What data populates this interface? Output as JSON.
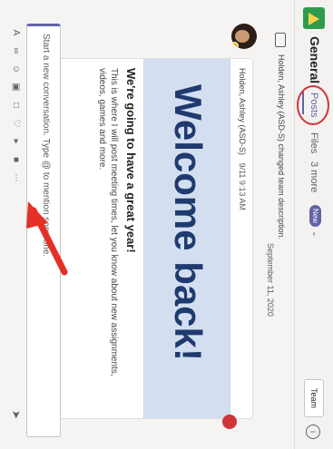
{
  "header": {
    "channel_name": "General",
    "tabs": [
      {
        "label": "Posts"
      },
      {
        "label": "Files"
      },
      {
        "label": "3 more"
      }
    ],
    "new_badge": "New",
    "team_button": "Team"
  },
  "system_message": {
    "text": "Holden, Ashley (ASD-S) changed team description.",
    "date": "September 11, 2020"
  },
  "post": {
    "author": "Holden, Ashley (ASD-S)",
    "time": "9/11 9:13 AM",
    "banner_text": "Welcome back!",
    "heading": "We're going to have a great year!",
    "body": "This is where I will post meeting times, let you know about new assignments, videos, games and more."
  },
  "composer": {
    "placeholder": "Start a new conversation. Type @ to mention someone."
  },
  "toolbar_icons": [
    "format-icon",
    "attach-icon",
    "emoji-icon",
    "gif-icon",
    "sticker-icon",
    "praise-icon",
    "meet-icon",
    "stream-icon",
    "more-icon"
  ],
  "colors": {
    "accent": "#6264a7",
    "annotation": "#d13438",
    "banner": "#d3dff0",
    "banner_text": "#1f3a6f"
  }
}
